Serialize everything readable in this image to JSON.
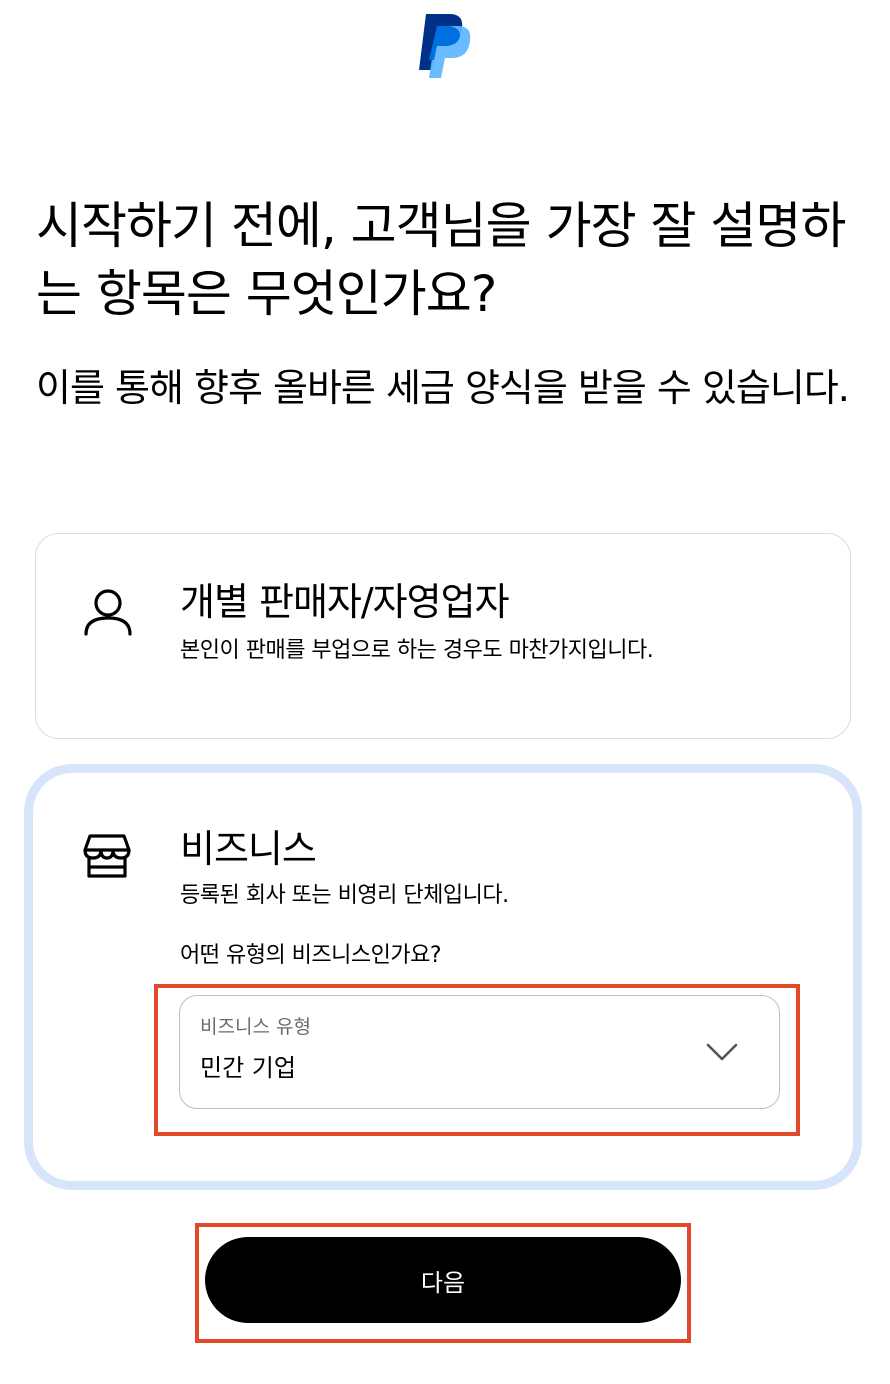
{
  "brand": {
    "logo_icon": "paypal-logo-icon",
    "colors": {
      "dark_blue": "#003087",
      "mid_blue": "#0070e0",
      "light_blue": "#60b8ff"
    }
  },
  "header": {
    "title": "시작하기 전에, 고객님을 가장 잘 설명하는 항목은 무엇인가요?",
    "subtitle": "이를 통해 향후 올바른 세금 양식을 받을 수 있습니다."
  },
  "options": {
    "individual": {
      "icon": "person-icon",
      "title": "개별 판매자/자영업자",
      "description": "본인이 판매를 부업으로 하는 경우도 마찬가지입니다."
    },
    "business": {
      "icon": "storefront-icon",
      "title": "비즈니스",
      "description": "등록된 회사 또는 비영리 단체입니다.",
      "question": "어떤 유형의 비즈니스인가요?",
      "select": {
        "label": "비즈니스 유형",
        "value": "민간 기업",
        "icon": "chevron-down-icon"
      }
    }
  },
  "footer": {
    "next_label": "다음"
  },
  "colors": {
    "selected_card_border": "#d6e5fa",
    "highlight_outline": "#e04a2a",
    "button_bg": "#000000"
  }
}
